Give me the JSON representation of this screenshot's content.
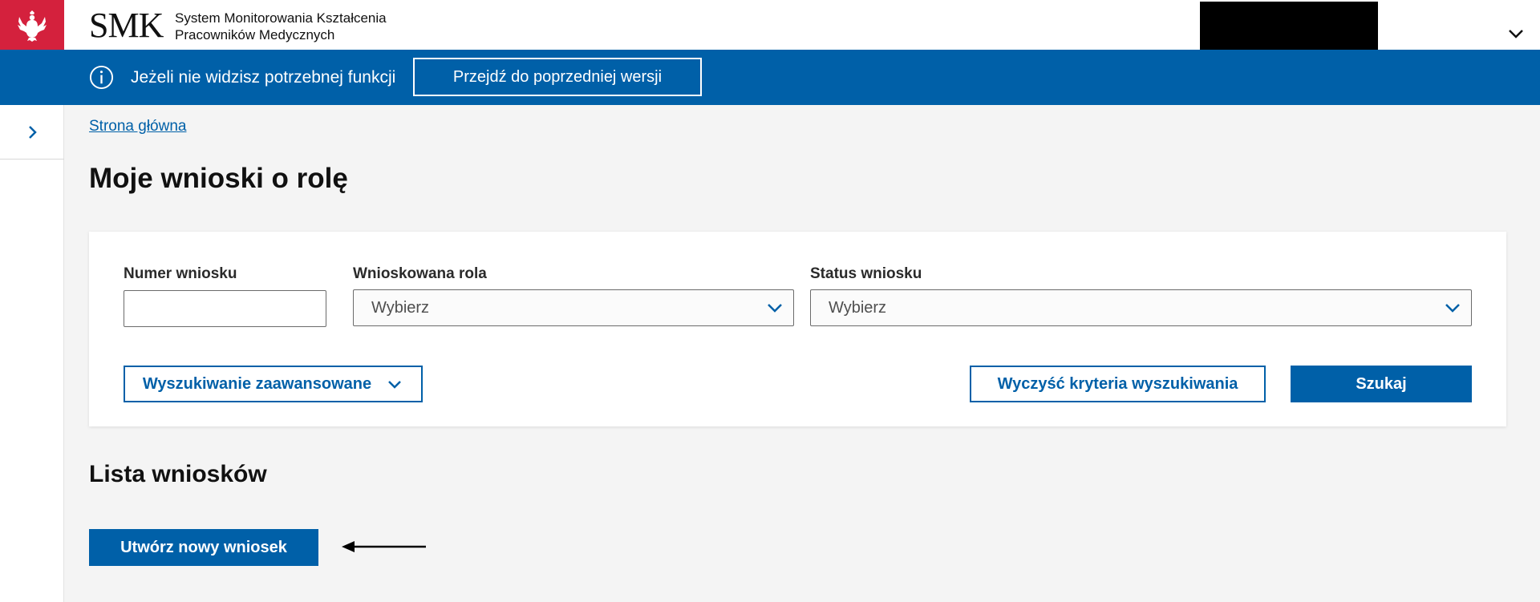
{
  "header": {
    "brand": "SMK",
    "title_line1": "System Monitorowania Kształcenia",
    "title_line2": "Pracowników Medycznych",
    "emblem_icon": "polish-eagle-icon",
    "user_menu_icon": "chevron-down-icon",
    "emblem_color": "#d4213d"
  },
  "infobar": {
    "icon": "info-icon",
    "text": "Jeżeli nie widzisz potrzebnej funkcji",
    "button_label": "Przejdź do poprzedniej wersji",
    "color": "#0060a8"
  },
  "sidebar": {
    "toggle_icon": "chevron-right-icon"
  },
  "breadcrumb": {
    "home": "Strona główna"
  },
  "page": {
    "title": "Moje wnioski o rolę"
  },
  "search_form": {
    "number_label": "Numer wniosku",
    "number_value": "",
    "role_label": "Wnioskowana rola",
    "role_value": "Wybierz",
    "status_label": "Status wniosku",
    "status_value": "Wybierz",
    "advanced_label": "Wyszukiwanie zaawansowane",
    "clear_label": "Wyczyść kryteria wyszukiwania",
    "search_label": "Szukaj"
  },
  "list": {
    "title": "Lista wniosków",
    "create_label": "Utwórz nowy wniosek",
    "annotation_icon": "arrow-left-icon"
  }
}
